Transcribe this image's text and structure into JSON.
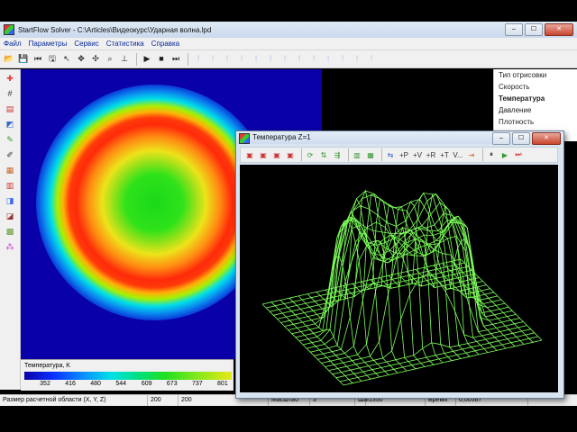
{
  "app": {
    "title": "StartFlow Solver - C:\\Articles\\Видеокурс\\Ударная волна.lpd",
    "window_buttons": {
      "minimize": "–",
      "maximize": "☐",
      "close": "✕"
    }
  },
  "menu": [
    "Файл",
    "Параметры",
    "Сервис",
    "Статистика",
    "Справка"
  ],
  "toolbar": {
    "icons": [
      "open-icon",
      "save-icon",
      "first-icon",
      "disk-icon",
      "pointer-icon",
      "move-icon",
      "pan-icon",
      "zoom-icon",
      "axes-icon",
      "sep",
      "play-icon",
      "stop-icon",
      "step-icon",
      "sep",
      "tool-a-icon",
      "tool-b-icon",
      "tool-c-icon",
      "tool-d-icon",
      "tool-e-icon",
      "tool-f-icon",
      "tool-g-icon",
      "tool-h-icon",
      "tool-i-icon",
      "tool-j-icon",
      "tool-k-icon",
      "tool-l-icon",
      "tool-m-icon"
    ]
  },
  "left_tools": [
    "cross-icon",
    "grid-icon",
    "palette-icon",
    "fill-icon",
    "dropper-icon",
    "pen-icon",
    "stack-icon",
    "bars-icon",
    "color-icon",
    "gradient-icon",
    "blocks-icon",
    "spray-icon"
  ],
  "right_panel": {
    "header": "Тип отрисовки",
    "items": [
      "Скорость",
      "Температура",
      "Давление",
      "Плотность"
    ],
    "selected": "Температура"
  },
  "colorbar": {
    "title": "Температура, K",
    "ticks": [
      "352",
      "416",
      "480",
      "544",
      "609",
      "673",
      "737",
      "801"
    ],
    "tick_fractions": [
      0.1,
      0.222,
      0.344,
      0.466,
      0.59,
      0.712,
      0.834,
      0.956
    ]
  },
  "status": {
    "domain_label": "Размер расчетной области (X, Y, Z)",
    "x": "200",
    "y": "200",
    "scale_label": "Масштаб",
    "scale": "3",
    "step_label": "Шаг",
    "step": "1350",
    "time_label": "Время",
    "time": "0,00587"
  },
  "subwindow": {
    "title": "Температура Z=1",
    "toolbar": [
      "▣",
      "▣",
      "▣",
      "▣",
      "sep",
      "⟳",
      "⇅",
      "⇶",
      "sep",
      "▥",
      "▦",
      "sep",
      "⇆",
      "+P",
      "+V",
      "+R",
      "+T",
      "V...",
      "⇥",
      "sep",
      "⏸",
      "▶",
      "⏭"
    ]
  },
  "colors": {
    "mesh": "#7dff5a",
    "background": "#000000",
    "field_base": "#0a00a8"
  }
}
